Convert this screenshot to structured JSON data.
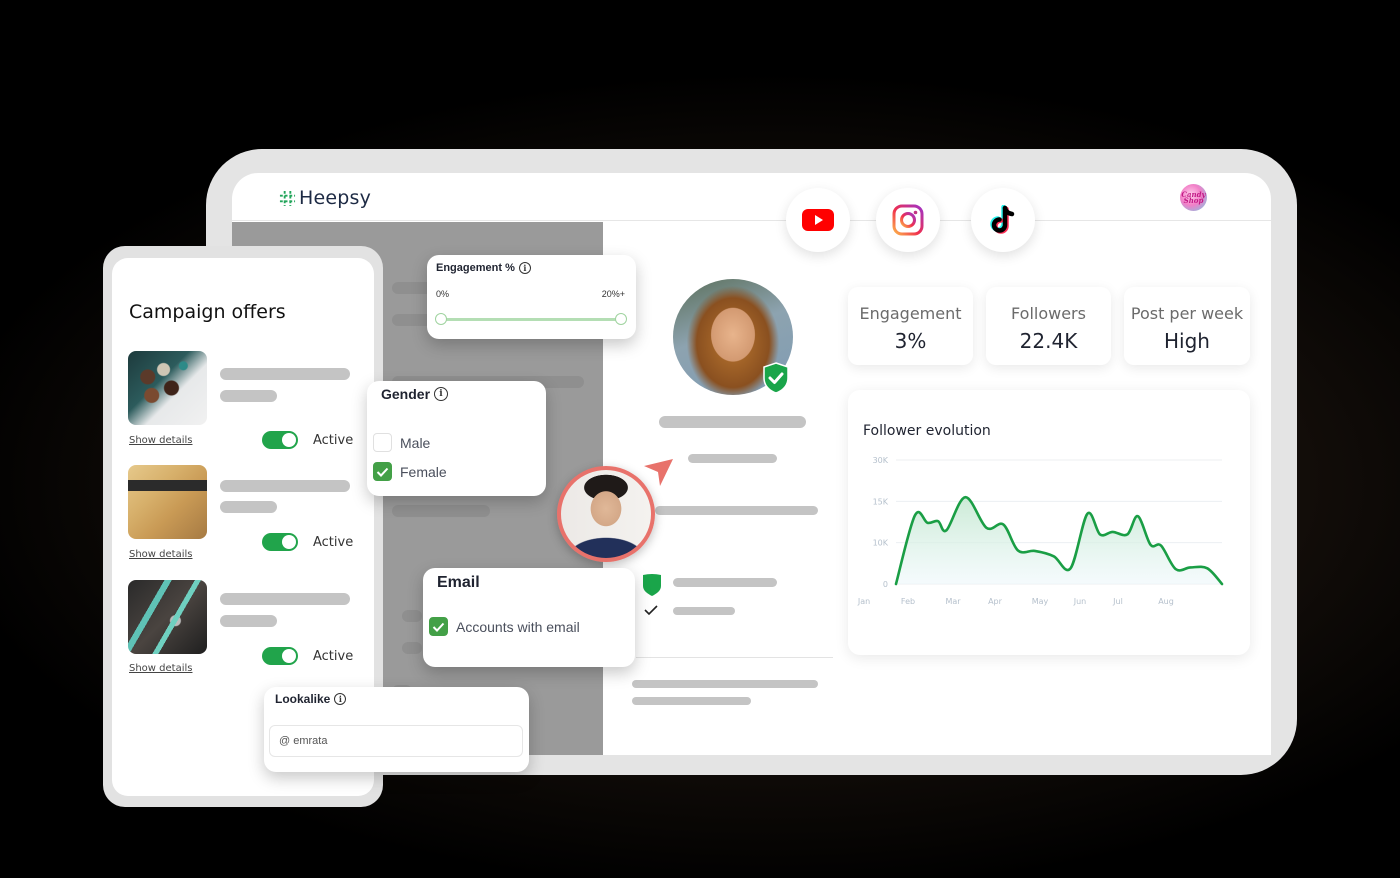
{
  "app": {
    "name": "Heepsy",
    "brand_badge": "Candy Shop",
    "accent_color": "#21a44b"
  },
  "social": [
    {
      "name": "YouTube",
      "icon": "youtube-icon"
    },
    {
      "name": "Instagram",
      "icon": "instagram-icon"
    },
    {
      "name": "TikTok",
      "icon": "tiktok-icon"
    }
  ],
  "filters": {
    "engagement": {
      "title": "Engagement %",
      "min_label": "0%",
      "max_label": "20%+",
      "range_low_fraction": 0,
      "range_high_fraction": 1
    },
    "gender": {
      "title": "Gender",
      "options": [
        {
          "label": "Male",
          "checked": false
        },
        {
          "label": "Female",
          "checked": true
        }
      ]
    },
    "email": {
      "title": "Email",
      "options": [
        {
          "label": "Accounts with email",
          "checked": true
        }
      ]
    },
    "lookalike": {
      "title": "Lookalike",
      "value": "@ emrata"
    }
  },
  "campaign": {
    "title": "Campaign offers",
    "offers": [
      {
        "image": "chocolates",
        "link": "Show details",
        "status": "Active",
        "active": true
      },
      {
        "image": "cheese",
        "link": "Show details",
        "status": "Active",
        "active": true
      },
      {
        "image": "bicycle",
        "link": "Show details",
        "status": "Active",
        "active": true
      }
    ]
  },
  "stats": [
    {
      "label": "Engagement",
      "value": "3%"
    },
    {
      "label": "Followers",
      "value": "22.4K"
    },
    {
      "label": "Post per week",
      "value": "High"
    }
  ],
  "chart_data": {
    "type": "area",
    "title": "Follower evolution",
    "xlabel": "",
    "ylabel": "",
    "categories": [
      "Jan",
      "Feb",
      "Mar",
      "Apr",
      "May",
      "Jun",
      "Jul",
      "Aug"
    ],
    "y_tick_labels": [
      "0",
      "10K",
      "15K",
      "30K"
    ],
    "y_tick_values": [
      0,
      10000,
      15000,
      30000
    ],
    "grid": true,
    "color": "#1a9e45",
    "series": [
      {
        "name": "Followers",
        "x": [
          0,
          0.45,
          0.75,
          1.0,
          1.2,
          1.65,
          2.15,
          2.55,
          2.9,
          3.3,
          3.75,
          4.15,
          4.55,
          4.85,
          5.15,
          5.5,
          5.75,
          6.05,
          6.3,
          6.65,
          7.0,
          7.4,
          7.75
        ],
        "values": [
          0,
          13300,
          12400,
          12600,
          11500,
          16500,
          11800,
          12200,
          8100,
          8000,
          6700,
          3800,
          13500,
          11000,
          11300,
          11000,
          13200,
          9500,
          9300,
          3600,
          4000,
          3800,
          0
        ]
      }
    ],
    "ylim": [
      0,
      30000
    ]
  }
}
